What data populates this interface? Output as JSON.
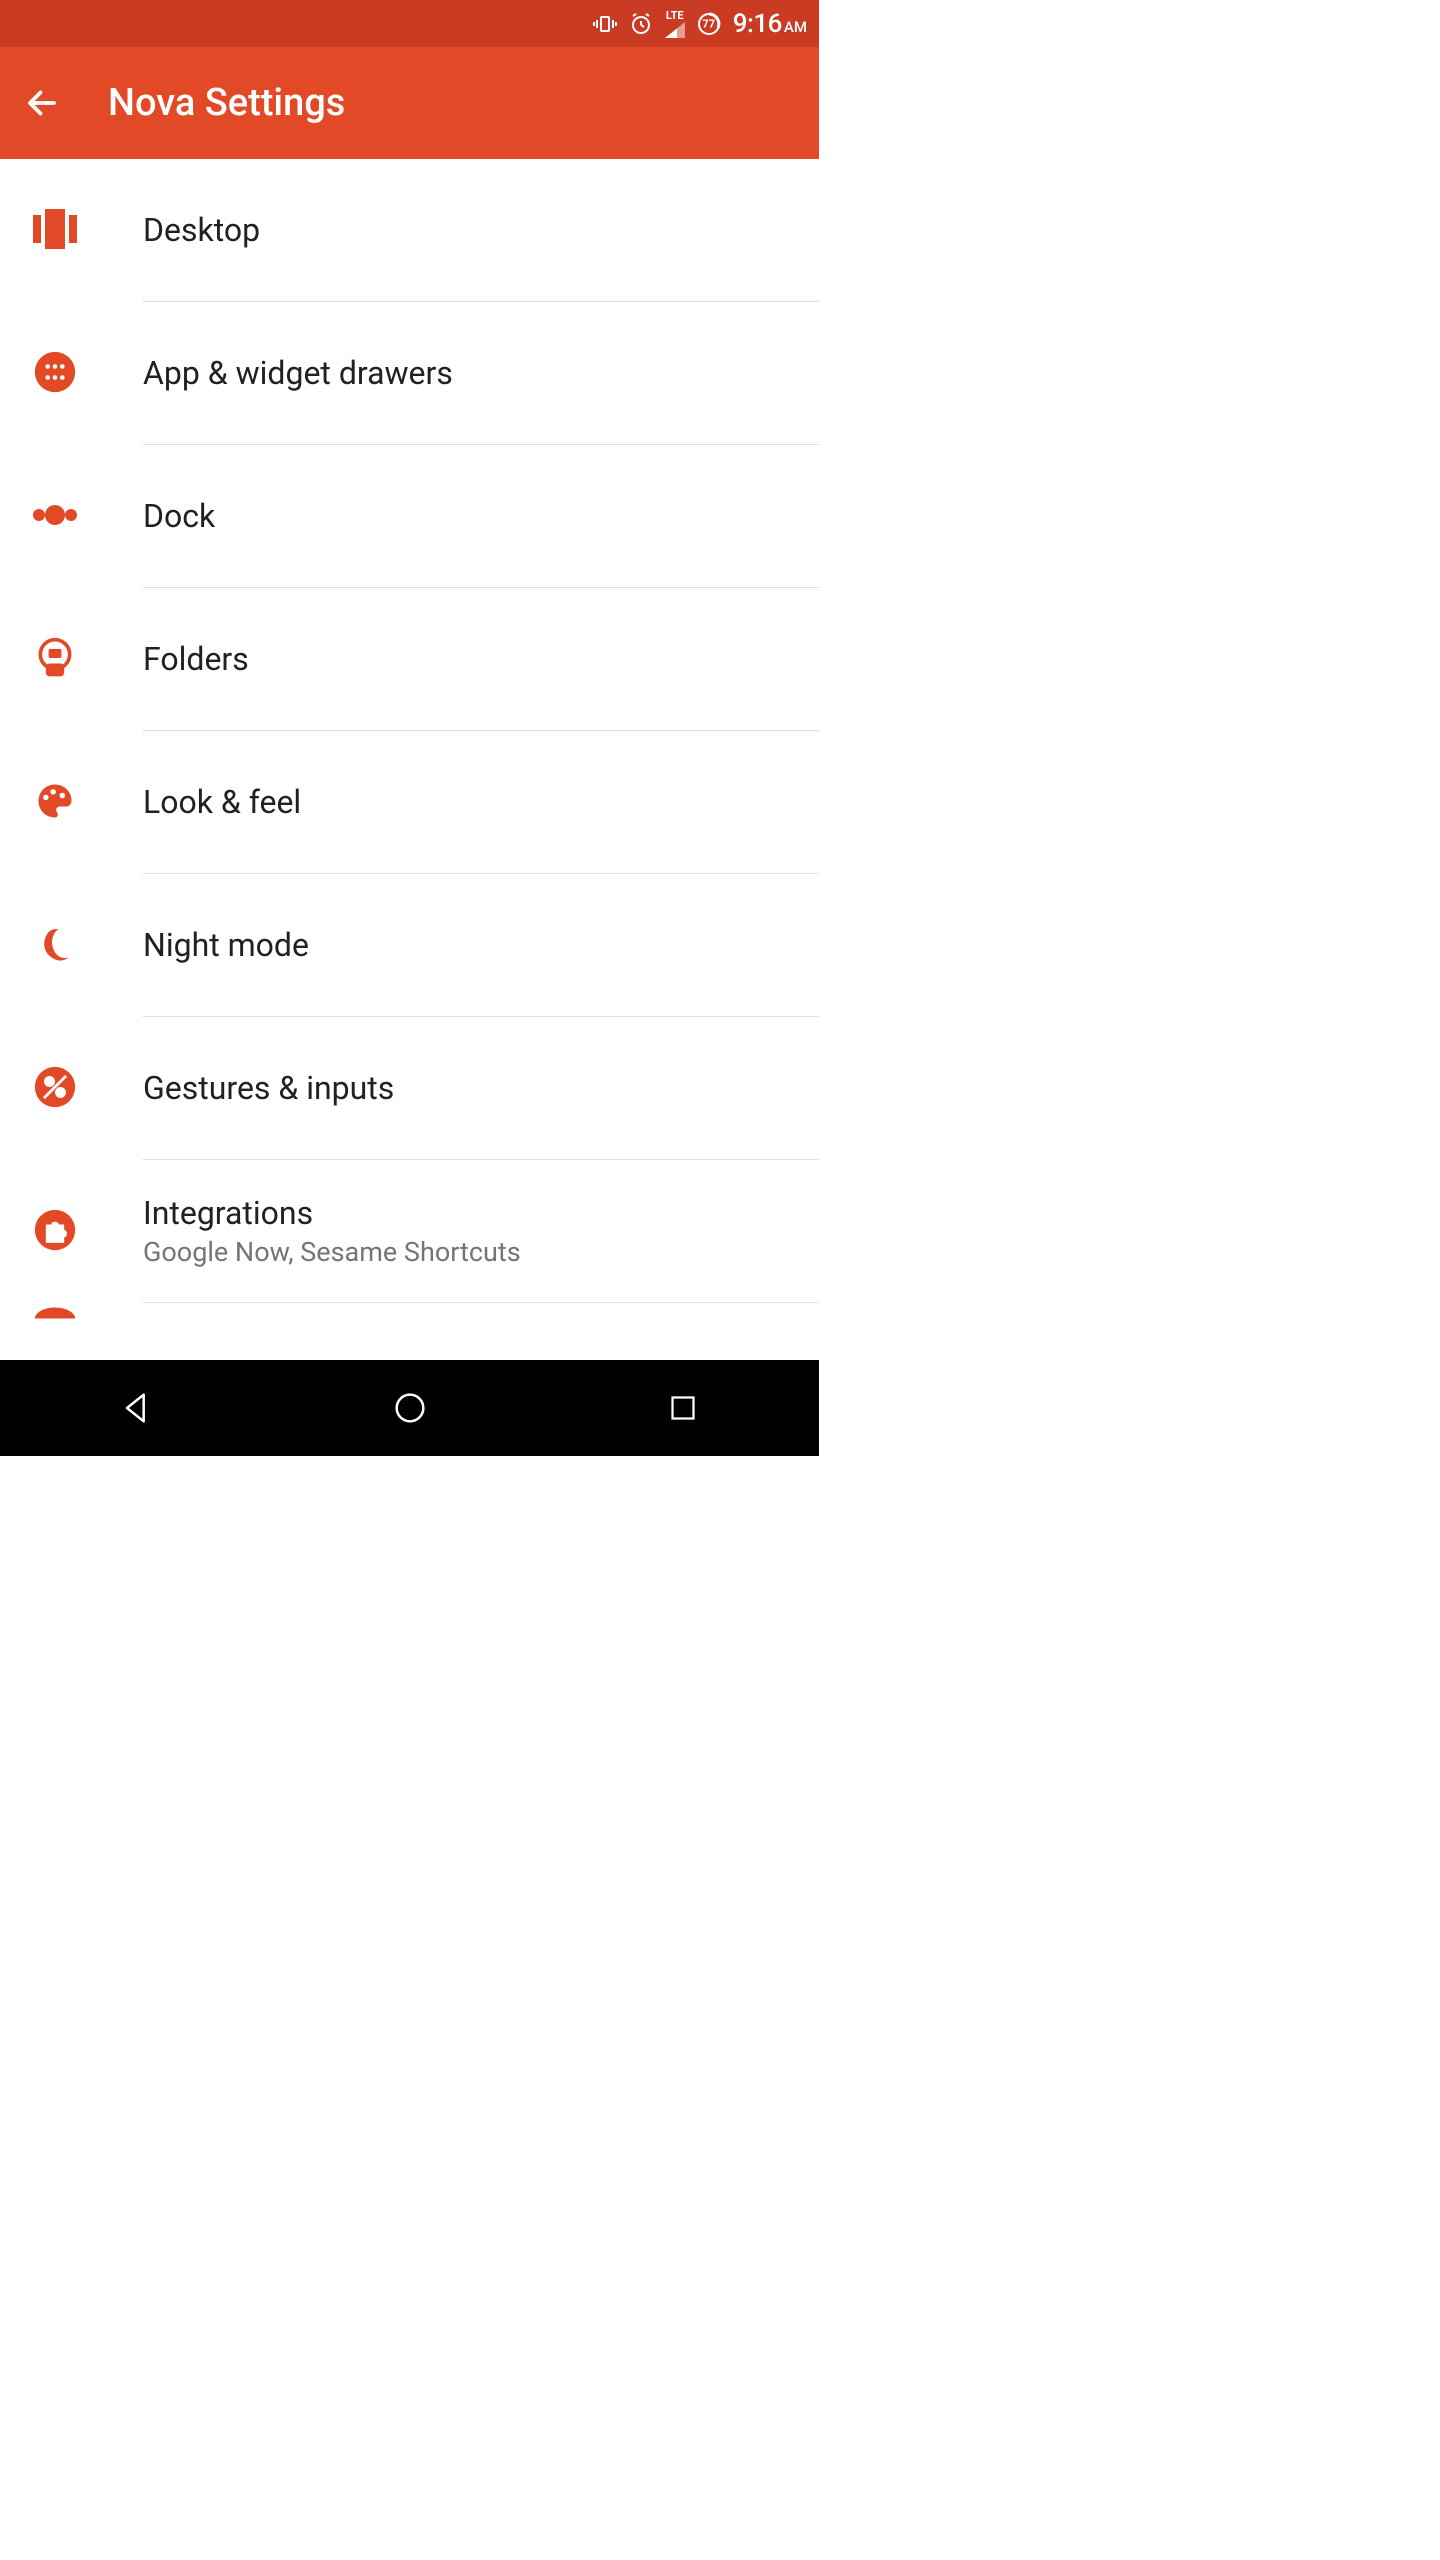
{
  "colors": {
    "primary": "#e24a27",
    "primaryDark": "#c93b23",
    "textPrimary": "#212121",
    "textSecondary": "#757575"
  },
  "statusBar": {
    "time": "9:16",
    "ampm": "AM",
    "batteryLevel": "77",
    "network": "LTE"
  },
  "appBar": {
    "title": "Nova Settings"
  },
  "settings": {
    "items": [
      {
        "icon": "desktop",
        "title": "Desktop"
      },
      {
        "icon": "appdrawer",
        "title": "App & widget drawers"
      },
      {
        "icon": "dock",
        "title": "Dock"
      },
      {
        "icon": "folders",
        "title": "Folders"
      },
      {
        "icon": "lookfeel",
        "title": "Look & feel"
      },
      {
        "icon": "nightmode",
        "title": "Night mode"
      },
      {
        "icon": "gestures",
        "title": "Gestures & inputs"
      },
      {
        "icon": "integrations",
        "title": "Integrations",
        "subtitle": "Google Now, Sesame Shortcuts"
      }
    ]
  }
}
